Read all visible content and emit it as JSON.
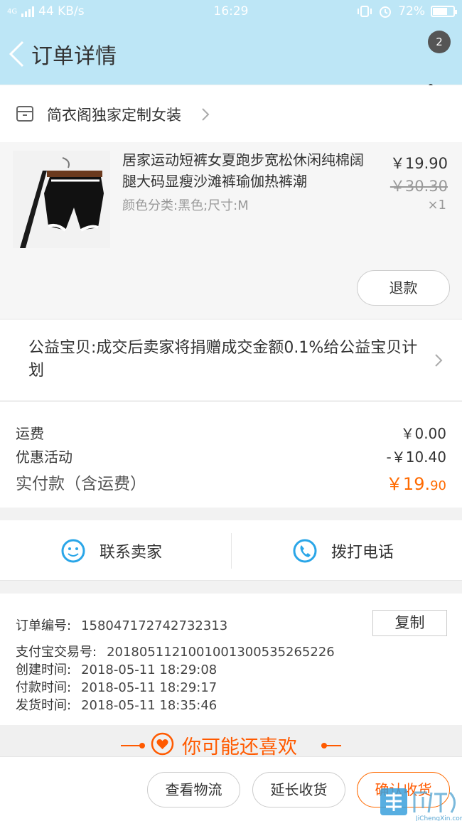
{
  "status_bar": {
    "network": "4G",
    "speed": "44 KB/s",
    "time": "16:29",
    "battery": "72%",
    "battery_level": 0.72
  },
  "nav": {
    "back_icon": "chevron-left-icon",
    "title": "订单详情",
    "badge_count": "2",
    "more_icon": "more-vertical-icon"
  },
  "shop": {
    "icon": "store-icon",
    "name": "简衣阁独家定制女装"
  },
  "product": {
    "title": "居家运动短裤女夏跑步宽松休闲纯棉阔腿大码显瘦沙滩裤瑜伽热裤潮",
    "sku": "颜色分类:黑色;尺寸:M",
    "price": "￥19.90",
    "original_price": "￥30.30",
    "quantity": "×1",
    "refund_label": "退款"
  },
  "charity": {
    "text": "公益宝贝:成交后卖家将捐赠成交金额0.1%给公益宝贝计划"
  },
  "fees": {
    "shipping_label": "运费",
    "shipping_value": "￥0.00",
    "discount_label": "优惠活动",
    "discount_value": "-￥10.40",
    "total_label": "实付款（含运费）",
    "total_main": "￥19.",
    "total_cents": "90"
  },
  "contact": {
    "seller_label": "联系卖家",
    "seller_icon": "chat-icon",
    "call_label": "拨打电话",
    "call_icon": "phone-icon"
  },
  "order_info": {
    "order_no_label": "订单编号:",
    "order_no": "158047172742732313",
    "copy_label": "复制",
    "alipay_label": "支付宝交易号:",
    "alipay_no": "2018051121001001300535265226",
    "created_label": "创建时间:",
    "created_value": "2018-05-11 18:29:08",
    "paid_label": "付款时间:",
    "paid_value": "2018-05-11 18:29:17",
    "shipped_label": "发货时间:",
    "shipped_value": "2018-05-11 18:35:46"
  },
  "recommend": {
    "title": "你可能还喜欢",
    "icon": "heart-icon"
  },
  "bottom_bar": {
    "logistics_label": "查看物流",
    "extend_label": "延长收货",
    "confirm_label": "确认收货"
  },
  "watermark": {
    "text": "JiChengXin.com"
  },
  "colors": {
    "header_bg": "#bde6f6",
    "accent_orange": "#ff5a00",
    "icon_blue": "#2aa6e8"
  }
}
